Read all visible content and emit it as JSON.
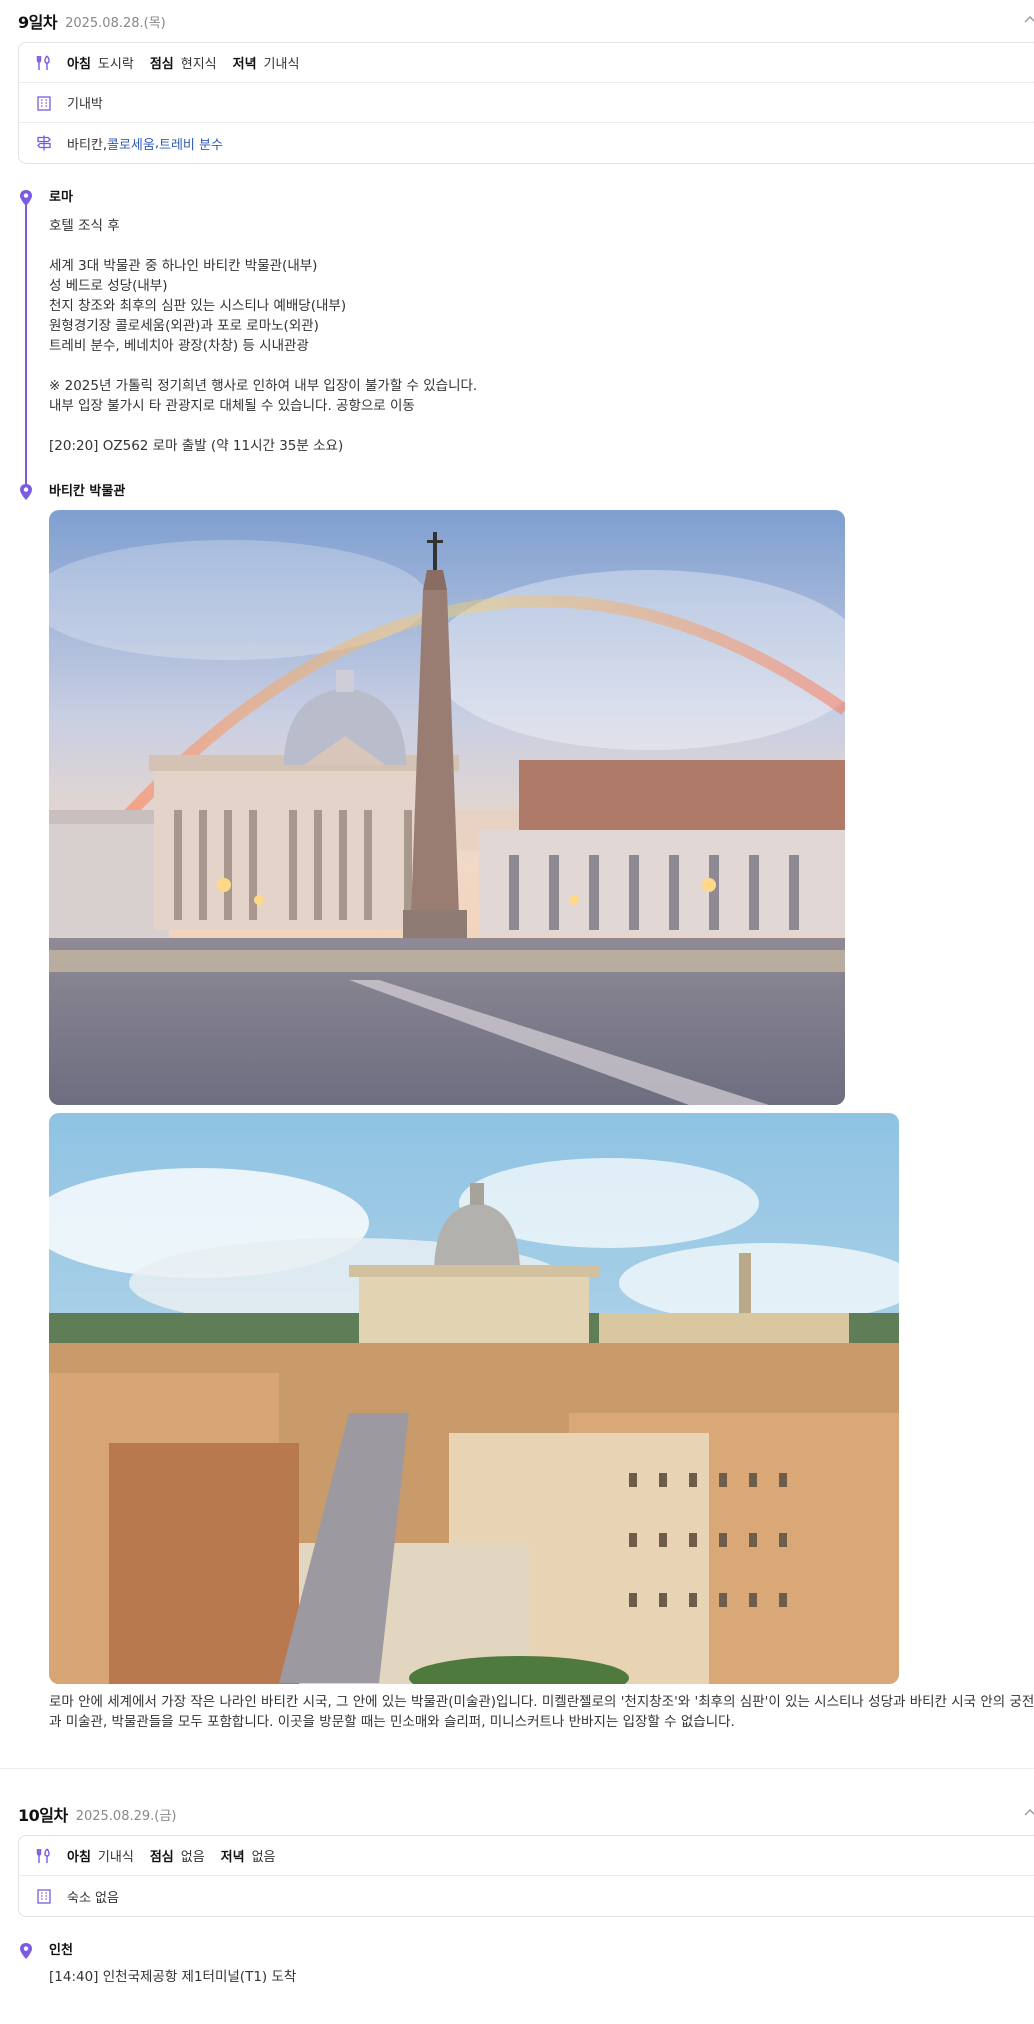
{
  "days": [
    {
      "title": "9일차",
      "date": "2025.08.28.(목)",
      "meals": {
        "breakfast_label": "아침",
        "breakfast": "도시락",
        "lunch_label": "점심",
        "lunch": "현지식",
        "dinner_label": "저녁",
        "dinner": "기내식"
      },
      "lodging": "기내박",
      "sights": {
        "plain": "바티칸, ",
        "link1": "콜로세움",
        "sep": ", ",
        "link2": "트레비 분수"
      },
      "stops": [
        {
          "name": "로마",
          "body": "호텔 조식 후\n\n세계 3대 박물관 중 하나인 바티칸 박물관(내부)\n성 베드로 성당(내부)\n천지 창조와 최후의 심판 있는 시스티나 예배당(내부)\n원형경기장 콜로세움(외관)과 포로 로마노(외관)\n트레비 분수, 베네치아 광장(차창) 등 시내관광\n\n※ 2025년 가톨릭 정기희년 행사로 인하여 내부 입장이 불가할 수 있습니다.\n내부 입장 불가시 타 관광지로 대체될 수 있습니다. 공항으로 이동\n\n[20:20] OZ562 로마 출발 (약 11시간 35분 소요)"
        },
        {
          "name": "바티칸 박물관",
          "description": "로마 안에 세계에서 가장 작은 나라인 바티칸 시국, 그 안에 있는 박물관(미술관)입니다. 미켈란젤로의 '천지창조'와 '최후의 심판'이 있는 시스티나 성당과 바티칸 시국 안의 궁전과 미술관, 박물관들을 모두 포함합니다. 이곳을 방문할 때는 민소매와 슬리퍼, 미니스커트나 반바지는 입장할 수 없습니다."
        }
      ]
    },
    {
      "title": "10일차",
      "date": "2025.08.29.(금)",
      "meals": {
        "breakfast_label": "아침",
        "breakfast": "기내식",
        "lunch_label": "점심",
        "lunch": "없음",
        "dinner_label": "저녁",
        "dinner": "없음"
      },
      "lodging": "숙소 없음",
      "stops": [
        {
          "name": "인천",
          "body": "[14:40] 인천국제공항 제1터미널(T1) 도착"
        }
      ]
    }
  ],
  "colors": {
    "accent": "#7b5be0",
    "link": "#2f5bb7"
  }
}
